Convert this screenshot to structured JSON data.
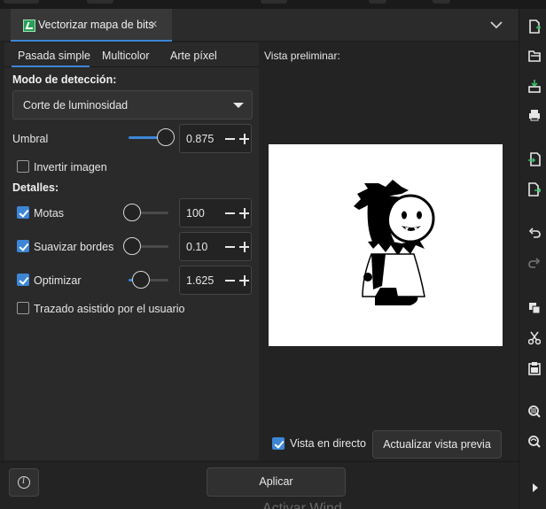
{
  "window": {
    "tab_title": "Vectorizar mapa de bits",
    "tab_close_symbol": "×",
    "accent_color": "#3d86d6"
  },
  "subtabs": [
    {
      "label": "Pasada simple",
      "active": true
    },
    {
      "label": "Multicolor",
      "active": false
    },
    {
      "label": "Arte píxel",
      "active": false
    }
  ],
  "detection": {
    "section_title": "Modo de detección:",
    "mode_selected": "Corte de luminosidad",
    "threshold": {
      "label": "Umbral",
      "value": "0.875",
      "slider_fraction": 0.875
    },
    "invert": {
      "label": "Invertir imagen",
      "checked": false
    }
  },
  "details": {
    "section_title": "Detalles:",
    "speckles": {
      "label": "Motas",
      "checked": true,
      "value": "100",
      "slider_fraction": 0.0
    },
    "smooth_corners": {
      "label": "Suavizar bordes",
      "checked": true,
      "value": "0.10",
      "slider_fraction": 0.0
    },
    "optimize": {
      "label": "Optimizar",
      "checked": true,
      "value": "1.625",
      "slider_fraction": 0.3
    },
    "assisted": {
      "label": "Trazado asistido por el usuario",
      "checked": false
    }
  },
  "preview": {
    "label": "Vista preliminar:",
    "live_preview": {
      "label": "Vista en directo",
      "checked": true
    },
    "update_button": "Actualizar vista previa"
  },
  "footer": {
    "info_icon": "info-icon",
    "apply_button": "Aplicar",
    "ghost_text": "Activar Wind"
  },
  "toolbar_icons": [
    "new-document-icon",
    "open-folder-icon",
    "save-icon",
    "print-icon",
    "import-icon",
    "export-icon",
    "undo-icon",
    "redo-icon",
    "duplicate-icon",
    "cut-icon",
    "paste-icon",
    "zoom-icon",
    "zoom-selection-icon",
    "expand-arrow-icon"
  ]
}
